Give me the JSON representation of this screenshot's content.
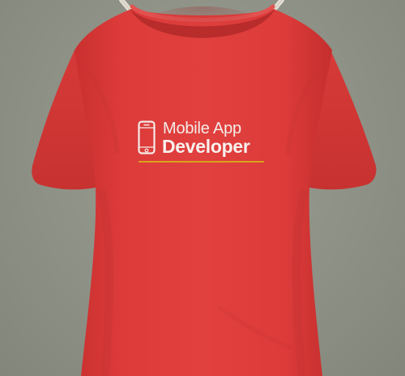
{
  "scene": {
    "background_color": "#8f9287",
    "shirt_color": "#dd3b3a",
    "hanger_color": "#e8e2d6"
  },
  "print": {
    "icon": "smartphone-icon",
    "line1": "Mobile App",
    "line2": "Developer",
    "text_color": "#f4ece8",
    "underline_color": "#d9a21d"
  }
}
